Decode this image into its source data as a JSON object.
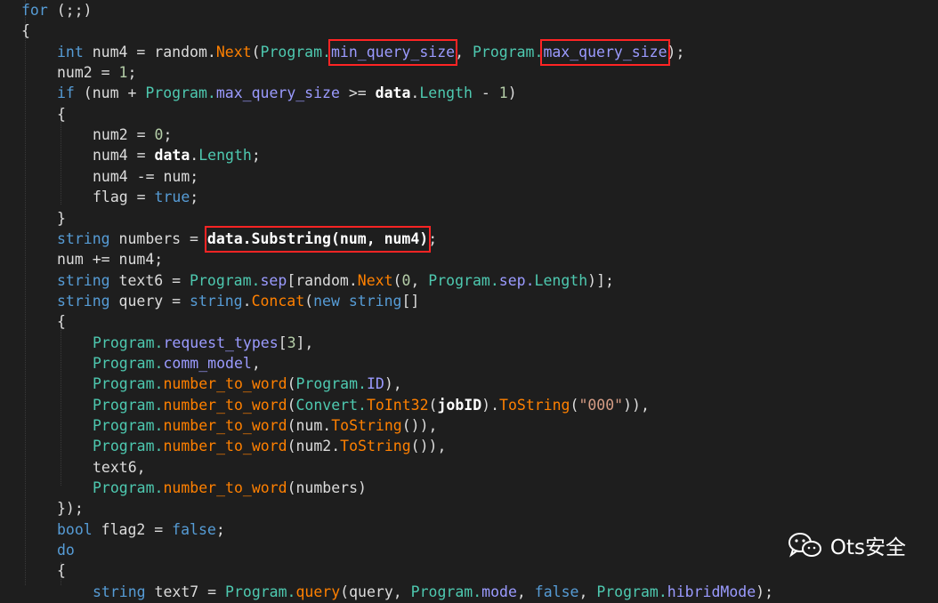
{
  "colors": {
    "background": "#1e1e1e",
    "keyword": "#569cd6",
    "type": "#4ec9b0",
    "method": "#ff8000",
    "property": "#9b9bff",
    "number": "#b5cea8",
    "string": "#d69d85",
    "plain": "#dcdcdc",
    "highlight_box": "#ff2424"
  },
  "watermark": {
    "text": "Ots安全",
    "icon": "wechat-icon"
  },
  "code": {
    "lines": [
      {
        "indent": 0,
        "tokens": [
          [
            "for",
            "kw"
          ],
          [
            " (;;)",
            "pl"
          ]
        ]
      },
      {
        "indent": 0,
        "tokens": [
          [
            "{",
            "pl"
          ]
        ]
      },
      {
        "indent": 1,
        "tokens": [
          [
            "int",
            "kw"
          ],
          [
            " num4 = random.",
            "pl"
          ],
          [
            "Next",
            "fn"
          ],
          [
            "(",
            "pl"
          ],
          [
            "Program.",
            "ty"
          ],
          [
            "min_query_size",
            "pr",
            "hl"
          ],
          [
            ", ",
            "pl"
          ],
          [
            "Program.",
            "ty"
          ],
          [
            "max_query_size",
            "pr",
            "hl"
          ],
          [
            ");",
            "pl"
          ]
        ]
      },
      {
        "indent": 1,
        "tokens": [
          [
            "num2 = ",
            "pl"
          ],
          [
            "1",
            "nm"
          ],
          [
            ";",
            "pl"
          ]
        ]
      },
      {
        "indent": 1,
        "tokens": [
          [
            "if",
            "kw"
          ],
          [
            " (num + ",
            "pl"
          ],
          [
            "Program.",
            "ty"
          ],
          [
            "max_query_size",
            "pr"
          ],
          [
            " >= ",
            "pl"
          ],
          [
            "data",
            "bd"
          ],
          [
            ".",
            "pl"
          ],
          [
            "Length",
            "ty"
          ],
          [
            " - ",
            "pl"
          ],
          [
            "1",
            "nm"
          ],
          [
            ")",
            "pl"
          ]
        ]
      },
      {
        "indent": 1,
        "tokens": [
          [
            "{",
            "pl"
          ]
        ]
      },
      {
        "indent": 2,
        "tokens": [
          [
            "num2 = ",
            "pl"
          ],
          [
            "0",
            "nm"
          ],
          [
            ";",
            "pl"
          ]
        ]
      },
      {
        "indent": 2,
        "tokens": [
          [
            "num4 = ",
            "pl"
          ],
          [
            "data",
            "bd"
          ],
          [
            ".",
            "pl"
          ],
          [
            "Length",
            "ty"
          ],
          [
            ";",
            "pl"
          ]
        ]
      },
      {
        "indent": 2,
        "tokens": [
          [
            "num4 -= num;",
            "pl"
          ]
        ]
      },
      {
        "indent": 2,
        "tokens": [
          [
            "flag = ",
            "pl"
          ],
          [
            "true",
            "kw"
          ],
          [
            ";",
            "pl"
          ]
        ]
      },
      {
        "indent": 1,
        "tokens": [
          [
            "}",
            "pl"
          ]
        ]
      },
      {
        "indent": 1,
        "tokens": [
          [
            "string",
            "kw"
          ],
          [
            " numbers = ",
            "pl"
          ],
          [
            "data.Substring(num, num4)",
            "bd",
            "hl"
          ],
          [
            ";",
            "pl"
          ]
        ]
      },
      {
        "indent": 1,
        "tokens": [
          [
            "num += num4;",
            "pl"
          ]
        ]
      },
      {
        "indent": 1,
        "tokens": [
          [
            "string",
            "kw"
          ],
          [
            " text6 = ",
            "pl"
          ],
          [
            "Program.",
            "ty"
          ],
          [
            "sep",
            "pr"
          ],
          [
            "[random.",
            "pl"
          ],
          [
            "Next",
            "fn"
          ],
          [
            "(",
            "pl"
          ],
          [
            "0",
            "nm"
          ],
          [
            ", ",
            "pl"
          ],
          [
            "Program.",
            "ty"
          ],
          [
            "sep.",
            "pr"
          ],
          [
            "Length",
            "ty"
          ],
          [
            ")];",
            "pl"
          ]
        ]
      },
      {
        "indent": 1,
        "tokens": [
          [
            "string",
            "kw"
          ],
          [
            " query = ",
            "pl"
          ],
          [
            "string",
            "kw"
          ],
          [
            ".",
            "pl"
          ],
          [
            "Concat",
            "fn"
          ],
          [
            "(",
            "pl"
          ],
          [
            "new",
            "kw"
          ],
          [
            " ",
            "pl"
          ],
          [
            "string",
            "kw"
          ],
          [
            "[]",
            "pl"
          ]
        ]
      },
      {
        "indent": 1,
        "tokens": [
          [
            "{",
            "pl"
          ]
        ]
      },
      {
        "indent": 2,
        "tokens": [
          [
            "Program.",
            "ty"
          ],
          [
            "request_types",
            "pr"
          ],
          [
            "[",
            "pl"
          ],
          [
            "3",
            "nm"
          ],
          [
            "],",
            "pl"
          ]
        ]
      },
      {
        "indent": 2,
        "tokens": [
          [
            "Program.",
            "ty"
          ],
          [
            "comm_model",
            "pr"
          ],
          [
            ",",
            "pl"
          ]
        ]
      },
      {
        "indent": 2,
        "tokens": [
          [
            "Program.",
            "ty"
          ],
          [
            "number_to_word",
            "fn"
          ],
          [
            "(",
            "pl"
          ],
          [
            "Program.",
            "ty"
          ],
          [
            "ID",
            "pr"
          ],
          [
            "),",
            "pl"
          ]
        ]
      },
      {
        "indent": 2,
        "tokens": [
          [
            "Program.",
            "ty"
          ],
          [
            "number_to_word",
            "fn"
          ],
          [
            "(",
            "pl"
          ],
          [
            "Convert.",
            "ty"
          ],
          [
            "ToInt32",
            "fn"
          ],
          [
            "(",
            "pl"
          ],
          [
            "jobID",
            "bd"
          ],
          [
            ").",
            "pl"
          ],
          [
            "ToString",
            "fn"
          ],
          [
            "(",
            "pl"
          ],
          [
            "\"000\"",
            "st"
          ],
          [
            ")),",
            "pl"
          ]
        ]
      },
      {
        "indent": 2,
        "tokens": [
          [
            "Program.",
            "ty"
          ],
          [
            "number_to_word",
            "fn"
          ],
          [
            "(num.",
            "pl"
          ],
          [
            "ToString",
            "fn"
          ],
          [
            "()),",
            "pl"
          ]
        ]
      },
      {
        "indent": 2,
        "tokens": [
          [
            "Program.",
            "ty"
          ],
          [
            "number_to_word",
            "fn"
          ],
          [
            "(num2.",
            "pl"
          ],
          [
            "ToString",
            "fn"
          ],
          [
            "()),",
            "pl"
          ]
        ]
      },
      {
        "indent": 2,
        "tokens": [
          [
            "text6,",
            "pl"
          ]
        ]
      },
      {
        "indent": 2,
        "tokens": [
          [
            "Program.",
            "ty"
          ],
          [
            "number_to_word",
            "fn"
          ],
          [
            "(numbers)",
            "pl"
          ]
        ]
      },
      {
        "indent": 1,
        "tokens": [
          [
            "});",
            "pl"
          ]
        ]
      },
      {
        "indent": 1,
        "tokens": [
          [
            "bool",
            "kw"
          ],
          [
            " flag2 = ",
            "pl"
          ],
          [
            "false",
            "kw"
          ],
          [
            ";",
            "pl"
          ]
        ]
      },
      {
        "indent": 1,
        "tokens": [
          [
            "do",
            "kw"
          ]
        ]
      },
      {
        "indent": 1,
        "tokens": [
          [
            "{",
            "pl"
          ]
        ]
      },
      {
        "indent": 2,
        "tokens": [
          [
            "string",
            "kw"
          ],
          [
            " text7 = ",
            "pl"
          ],
          [
            "Program.",
            "ty"
          ],
          [
            "query",
            "fn"
          ],
          [
            "(query, ",
            "pl"
          ],
          [
            "Program.",
            "ty"
          ],
          [
            "mode",
            "pr"
          ],
          [
            ", ",
            "pl"
          ],
          [
            "false",
            "kw"
          ],
          [
            ", ",
            "pl"
          ],
          [
            "Program.",
            "ty"
          ],
          [
            "hibridMode",
            "pr"
          ],
          [
            ");",
            "pl"
          ]
        ]
      }
    ]
  }
}
